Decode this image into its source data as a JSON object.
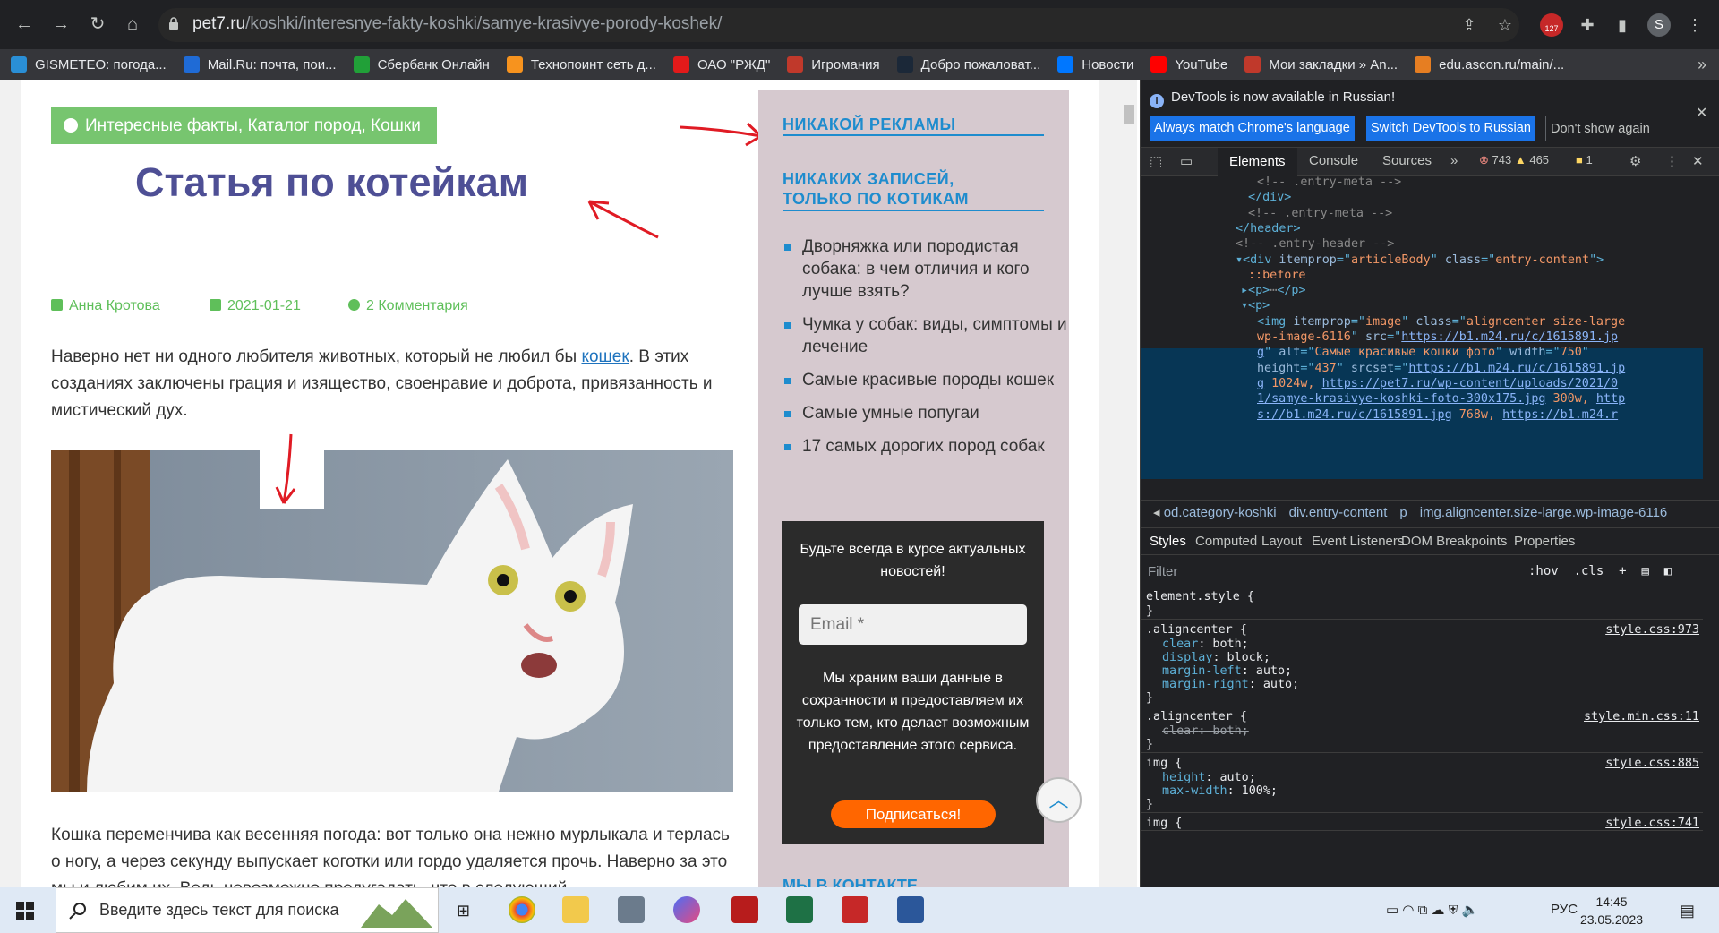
{
  "browser": {
    "url_host": "pet7.ru",
    "url_path": "/koshki/interesnye-fakty-koshki/samye-krasivye-porody-koshek/",
    "profile_initial": "S",
    "ext_badge": "127",
    "bookmarks": [
      {
        "label": "GISMETEO: погода...",
        "color": "#2a8fd6"
      },
      {
        "label": "Mail.Ru: почта, пои...",
        "color": "#1f6bd6"
      },
      {
        "label": "Сбербанк Онлайн",
        "color": "#21a038"
      },
      {
        "label": "Технопоинт сеть д...",
        "color": "#f7931e"
      },
      {
        "label": "ОАО \"РЖД\"",
        "color": "#e21a1a"
      },
      {
        "label": "Игромания",
        "color": "#c0392b"
      },
      {
        "label": "Добро пожаловат...",
        "color": "#1b2838"
      },
      {
        "label": "Новости",
        "color": "#0077ff"
      },
      {
        "label": "YouTube",
        "color": "#ff0000"
      },
      {
        "label": "Мои закладки » An...",
        "color": "#c0392b"
      },
      {
        "label": "edu.ascon.ru/main/...",
        "color": "#e67e22"
      }
    ]
  },
  "article": {
    "categories": "Интересные факты, Каталог пород, Кошки",
    "title": "Статья по котейкам",
    "author": "Анна Кротова",
    "date": "2021-01-21",
    "comments": "2 Комментария",
    "p1_before": "Наверно нет ни одного любителя животных, который не любил бы ",
    "p1_link": "кошек",
    "p1_after": ". В этих созданиях заключены грация и изящество, своенравие и доброта, привязанность и мистический дух.",
    "p2": "Кошка переменчива как весенняя погода: вот только она нежно мурлыкала и терлась о ногу, а через секунду выпускает коготки или гордо удаляется прочь. Наверно за это мы и любим их. Ведь невозможно предугадать, что в следующий"
  },
  "sidebar": {
    "heading1": "НИКАКОЙ РЕКЛАМЫ",
    "heading2": "НИКАКИХ ЗАПИСЕЙ, ТОЛЬКО ПО КОТИКАМ",
    "links": [
      "Дворняжка или породистая собака: в чем отличия и кого лучше взять?",
      "Чумка у собак: виды, симптомы и лечение",
      "Самые красивые породы кошек",
      "Самые умные попугаи",
      "17 самых дорогих пород собак"
    ],
    "newsletter_title": "Будьте всегда в курсе актуальных новостей!",
    "email_placeholder": "Email *",
    "newsletter_text": "Мы храним ваши данные в сохранности и предоставляем их только тем, кто делает возможным предоставление этого сервиса.",
    "subscribe": "Подписаться!",
    "heading3": "МЫ В КОНТАКТЕ"
  },
  "devtools": {
    "info": "DevTools is now available in Russian!",
    "btn_match": "Always match Chrome's language",
    "btn_switch": "Switch DevTools to Russian",
    "btn_dont": "Don't show again",
    "tabs": [
      "Elements",
      "Console",
      "Sources"
    ],
    "errors": "743",
    "warnings": "465",
    "issues": "1",
    "code_lines": [
      {
        "indent": 160,
        "parts": [
          [
            "cm",
            "<!-- .entry-meta -->"
          ]
        ]
      },
      {
        "indent": 150,
        "parts": [
          [
            "tag",
            "</div>"
          ]
        ]
      },
      {
        "indent": 150,
        "parts": [
          [
            "cm",
            "<!-- .entry-meta -->"
          ]
        ]
      },
      {
        "indent": 136,
        "parts": [
          [
            "tag",
            "</header>"
          ]
        ]
      },
      {
        "indent": 136,
        "parts": [
          [
            "cm",
            "<!-- .entry-header -->"
          ]
        ]
      },
      {
        "indent": 136,
        "parts": [
          [
            "tag",
            "▾<div "
          ],
          [
            "an",
            "itemprop"
          ],
          [
            "tag",
            "=\""
          ],
          [
            "av",
            "articleBody"
          ],
          [
            "tag",
            "\" "
          ],
          [
            "an",
            "class"
          ],
          [
            "tag",
            "=\""
          ],
          [
            "av",
            "entry-content"
          ],
          [
            "tag",
            "\">"
          ]
        ]
      },
      {
        "indent": 150,
        "parts": [
          [
            "av",
            "::before"
          ]
        ]
      },
      {
        "indent": 142,
        "parts": [
          [
            "tag",
            "▸<p>"
          ],
          [
            "cm",
            "⋯"
          ],
          [
            "tag",
            "</p>"
          ]
        ]
      },
      {
        "indent": 142,
        "parts": [
          [
            "tag",
            "▾<p>"
          ]
        ]
      },
      {
        "indent": 160,
        "parts": [
          [
            "tag",
            "<img "
          ],
          [
            "an",
            "itemprop"
          ],
          [
            "tag",
            "=\""
          ],
          [
            "av",
            "image"
          ],
          [
            "tag",
            "\" "
          ],
          [
            "an",
            "class"
          ],
          [
            "tag",
            "=\""
          ],
          [
            "av",
            "aligncenter size-large"
          ]
        ]
      },
      {
        "indent": 160,
        "parts": [
          [
            "av",
            "wp-image-6116"
          ],
          [
            "tag",
            "\" "
          ],
          [
            "an",
            "src"
          ],
          [
            "tag",
            "=\""
          ],
          [
            "lk",
            "https://b1.m24.ru/c/1615891.jp"
          ]
        ]
      },
      {
        "indent": 160,
        "parts": [
          [
            "lk",
            "g"
          ],
          [
            "tag",
            "\" "
          ],
          [
            "an",
            "alt"
          ],
          [
            "tag",
            "=\""
          ],
          [
            "av",
            "Самые красивые кошки фото"
          ],
          [
            "tag",
            "\" "
          ],
          [
            "an",
            "width"
          ],
          [
            "tag",
            "=\""
          ],
          [
            "av",
            "750"
          ],
          [
            "tag",
            "\""
          ]
        ]
      },
      {
        "indent": 160,
        "parts": [
          [
            "an",
            "height"
          ],
          [
            "tag",
            "=\""
          ],
          [
            "av",
            "437"
          ],
          [
            "tag",
            "\" "
          ],
          [
            "an",
            "srcset"
          ],
          [
            "tag",
            "=\""
          ],
          [
            "lk",
            "https://b1.m24.ru/c/1615891.jp"
          ]
        ]
      },
      {
        "indent": 160,
        "parts": [
          [
            "lk",
            "g"
          ],
          [
            "av",
            " 1024w, "
          ],
          [
            "lk",
            "https://pet7.ru/wp-content/uploads/2021/0"
          ]
        ]
      },
      {
        "indent": 160,
        "parts": [
          [
            "lk",
            "1/samye-krasivye-koshki-foto-300x175.jpg"
          ],
          [
            "av",
            " 300w, "
          ],
          [
            "lk",
            "http"
          ]
        ]
      },
      {
        "indent": 160,
        "parts": [
          [
            "lk",
            "s://b1.m24.ru/c/1615891.jpg"
          ],
          [
            "av",
            " 768w, "
          ],
          [
            "lk",
            "https://b1.m24.r"
          ]
        ]
      }
    ],
    "crumbs": [
      "od.category-koshki",
      "div.entry-content",
      "p",
      "img.aligncenter.size-large.wp-image-6116"
    ],
    "style_tabs": [
      "Styles",
      "Computed",
      "Layout",
      "Event Listeners",
      "DOM Breakpoints",
      "Properties"
    ],
    "filter": "Filter",
    "hov": ":hov",
    "cls": ".cls",
    "rules": [
      {
        "selector": "element.style {",
        "source": "",
        "props": [],
        "close": "}"
      },
      {
        "selector": ".aligncenter {",
        "source": "style.css:973",
        "props": [
          [
            "clear",
            "both"
          ],
          [
            "display",
            "block"
          ],
          [
            "margin-left",
            "auto"
          ],
          [
            "margin-right",
            "auto"
          ]
        ],
        "close": "}"
      },
      {
        "selector": ".aligncenter {",
        "source": "style.min.css:11",
        "props": [
          [
            "clear",
            "both",
            "strike"
          ]
        ],
        "close": "}"
      },
      {
        "selector": "img {",
        "source": "style.css:885",
        "props": [
          [
            "height",
            "auto"
          ],
          [
            "max-width",
            "100%"
          ]
        ],
        "close": "}"
      },
      {
        "selector": "img {",
        "source": "style.css:741",
        "props": [],
        "close": ""
      }
    ]
  },
  "taskbar": {
    "search_placeholder": "Введите здесь текст для поиска",
    "lang": "РУС",
    "time": "14:45",
    "date": "23.05.2023"
  }
}
